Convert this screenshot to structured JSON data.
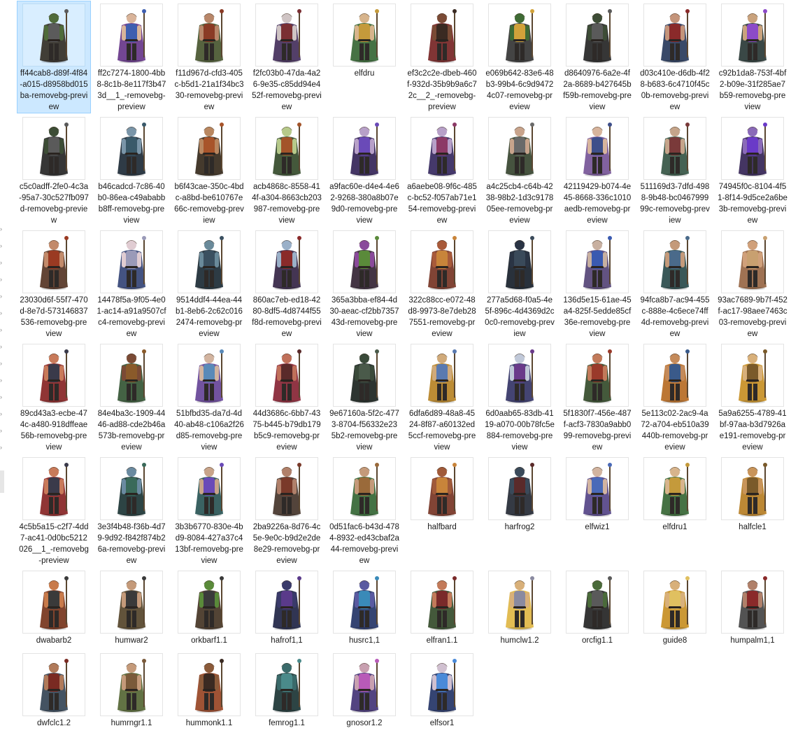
{
  "files": [
    {
      "name": "ff44cab8-d89f-4f84-a015-d8958bd015ba-removebg-preview",
      "selected": true,
      "colors": {
        "skin": "#4f6b3a",
        "cloth": "#39342c",
        "accent": "#5b5b5b"
      },
      "icon": "green-warrior-icon"
    },
    {
      "name": "ff2c7274-1800-4bb8-8c1b-8e117f3b473d__1_-removebg-preview",
      "colors": {
        "skin": "#d9b49a",
        "cloth": "#6b3c8c",
        "accent": "#3f5fb0"
      },
      "icon": "sorceress-icon"
    },
    {
      "name": "f11d967d-cfd3-405c-b5d1-21a1f34bc330-removebg-preview",
      "colors": {
        "skin": "#b8876a",
        "cloth": "#4d5b35",
        "accent": "#8a3b25"
      },
      "icon": "ranger-icon"
    },
    {
      "name": "f2fc03b0-47da-4a26-9e35-c85dd94e452f-removebg-preview",
      "colors": {
        "skin": "#cfc4c4",
        "cloth": "#4a3560",
        "accent": "#7a2f33"
      },
      "icon": "mage-icon"
    },
    {
      "name": "elfdru",
      "colors": {
        "skin": "#d7b48c",
        "cloth": "#3c6a3a",
        "accent": "#c49a3b"
      },
      "icon": "druid-icon"
    },
    {
      "name": "ef3c2c2e-dbeb-460f-932d-35b9b9a6c72c__2_-removebg-preview",
      "colors": {
        "skin": "#7a4a35",
        "cloth": "#7a2a2a",
        "accent": "#3a2a22"
      },
      "icon": "fighter-icon"
    },
    {
      "name": "e069b642-83e6-48b3-99b4-6c9d94724c07-removebg-preview",
      "colors": {
        "skin": "#3f6b35",
        "cloth": "#3a3a3a",
        "accent": "#d1a23a"
      },
      "icon": "orc-icon"
    },
    {
      "name": "d8640976-6a2e-4f2a-8689-b427645bf59b-removebg-preview",
      "colors": {
        "skin": "#3d4c36",
        "cloth": "#2b2b2b",
        "accent": "#5a5a5a"
      },
      "icon": "armored-orc-icon"
    },
    {
      "name": "d03c410e-d6db-4f28-b683-6c4710f45c0b-removebg-preview",
      "colors": {
        "skin": "#c4947a",
        "cloth": "#2e3f60",
        "accent": "#8a2a2a"
      },
      "icon": "knight-icon"
    },
    {
      "name": "c92b1da8-753f-4bf2-b09e-31f285ae7b59-removebg-preview",
      "colors": {
        "skin": "#c9a27d",
        "cloth": "#2f3e3c",
        "accent": "#8c4ac8"
      },
      "icon": "gnome-mage-icon"
    },
    {
      "name": "c5c0adff-2fe0-4c3a-95a7-30c527fb097d-removebg-preview",
      "colors": {
        "skin": "#3d4d36",
        "cloth": "#2b2b2b",
        "accent": "#5a5a5a"
      },
      "icon": "orc-guard-icon"
    },
    {
      "name": "b46cadcd-7c86-40b0-86ea-c49ababbb8ff-removebg-preview",
      "colors": {
        "skin": "#7a95a8",
        "cloth": "#24303c",
        "accent": "#3a5a6a"
      },
      "icon": "drow-icon"
    },
    {
      "name": "b6f43cae-350c-4bdc-a8bd-be610767e66c-removebg-preview",
      "colors": {
        "skin": "#b98760",
        "cloth": "#3b2f22",
        "accent": "#a8542a"
      },
      "icon": "monk-icon"
    },
    {
      "name": "acb4868c-8558-414f-a304-8663cb203987-removebg-preview",
      "colors": {
        "skin": "#b6c98a",
        "cloth": "#3a4f30",
        "accent": "#a3542a"
      },
      "icon": "goblin-icon"
    },
    {
      "name": "a9fac60e-d4e4-4e62-9268-380a8b07e9d0-removebg-preview",
      "colors": {
        "skin": "#b7a0c8",
        "cloth": "#3a2a5c",
        "accent": "#6a4ab8"
      },
      "icon": "witch-icon"
    },
    {
      "name": "a6aebe08-9f6c-485c-bc52-f057ab71e154-removebg-preview",
      "colors": {
        "skin": "#b7a0c8",
        "cloth": "#3b2e63",
        "accent": "#8c3a66"
      },
      "icon": "warlock-icon"
    },
    {
      "name": "a4c25cb4-c64b-4238-98b2-1d3c917805ee-removebg-preview",
      "colors": {
        "skin": "#c8a48c",
        "cloth": "#3c4a35",
        "accent": "#6a6a6a"
      },
      "icon": "swordsman-icon"
    },
    {
      "name": "42119429-b074-4e45-8668-336c1010aedb-removebg-preview",
      "colors": {
        "skin": "#d7b49c",
        "cloth": "#7a5a9a",
        "accent": "#3e4f8a"
      },
      "icon": "priestess-icon"
    },
    {
      "name": "511169d3-7dfd-4988-9b48-bc046799999c-removebg-preview",
      "colors": {
        "skin": "#c5a48a",
        "cloth": "#3b5a4a",
        "accent": "#7a3a3a"
      },
      "icon": "bard-icon"
    },
    {
      "name": "74945f0c-8104-4f51-8f14-9d5ce2a6be3b-removebg-preview",
      "colors": {
        "skin": "#8a6ab8",
        "cloth": "#3a2a5a",
        "accent": "#6a3ac8"
      },
      "icon": "tiefling-icon"
    },
    {
      "name": "23030d6f-55f7-470d-8e7d-573146837536-removebg-preview",
      "colors": {
        "skin": "#c28a6a",
        "cloth": "#5a3a2a",
        "accent": "#9a3a22"
      },
      "icon": "barbarian-icon"
    },
    {
      "name": "14478f5a-9f05-4e01-ac14-a91a9507cfc4-removebg-preview",
      "colors": {
        "skin": "#e0ccd2",
        "cloth": "#3a4a7a",
        "accent": "#9a9ab8"
      },
      "icon": "elf-mage-icon"
    },
    {
      "name": "9514ddf4-44ea-44b1-8eb6-2c62c0162474-removebg-preview",
      "colors": {
        "skin": "#6a8a9a",
        "cloth": "#22303a",
        "accent": "#3a5060"
      },
      "icon": "rogue-icon"
    },
    {
      "name": "860ac7eb-ed18-4280-8df5-4d8744f55f8d-removebg-preview",
      "colors": {
        "skin": "#9ab0c8",
        "cloth": "#3a2a4a",
        "accent": "#8a2a2a"
      },
      "icon": "sorcerer-icon"
    },
    {
      "name": "365a3bba-ef84-4d30-aeac-cf2bb735743d-removebg-preview",
      "colors": {
        "skin": "#8a4a9a",
        "cloth": "#3a2a3a",
        "accent": "#5a8a3a"
      },
      "icon": "jester-icon"
    },
    {
      "name": "322c88cc-e072-48d8-9973-8e7deb287551-removebg-preview",
      "colors": {
        "skin": "#a85a3a",
        "cloth": "#7a3a2a",
        "accent": "#c8843a"
      },
      "icon": "lute-bard-icon"
    },
    {
      "name": "277a5d68-f0a5-4e5f-896c-4d4369d2c0c0-removebg-preview",
      "colors": {
        "skin": "#2a3444",
        "cloth": "#1e2630",
        "accent": "#3a4a5a"
      },
      "icon": "shadow-icon"
    },
    {
      "name": "136d5e15-61ae-45a4-825f-5edde85cf36e-removebg-preview",
      "colors": {
        "skin": "#c8b0a0",
        "cloth": "#5a4a7a",
        "accent": "#3a5ab0"
      },
      "icon": "cleric-icon"
    },
    {
      "name": "94fca8b7-ac94-455c-888e-4c6ece74ff4d-removebg-preview",
      "colors": {
        "skin": "#c49a7a",
        "cloth": "#2f4f4f",
        "accent": "#4a6a8a"
      },
      "icon": "sailor-icon"
    },
    {
      "name": "93ac7689-9b7f-452f-ac17-98aee7463c03-removebg-preview",
      "colors": {
        "skin": "#d0a07a",
        "cloth": "#9a6a4a",
        "accent": "#c8a070"
      },
      "icon": "halfling-icon"
    },
    {
      "name": "89cd43a3-ecbe-474c-a480-918dffeae56b-removebg-preview",
      "colors": {
        "skin": "#c87a5a",
        "cloth": "#8a2a2a",
        "accent": "#3a3a4a"
      },
      "icon": "axe-fighter-icon"
    },
    {
      "name": "84e4ba3c-1909-4446-ad88-cde2b46a573b-removebg-preview",
      "colors": {
        "skin": "#7a4a35",
        "cloth": "#3a5a3a",
        "accent": "#8a5a2a"
      },
      "icon": "scout-icon"
    },
    {
      "name": "51bfbd35-da7d-4d40-ab48-c106a2f26d85-removebg-preview",
      "colors": {
        "skin": "#d2b4a0",
        "cloth": "#6a4a9a",
        "accent": "#5a8ab8"
      },
      "icon": "enchantress-icon"
    },
    {
      "name": "44d3686c-6bb7-4375-b445-b79db179b5c9-removebg-preview",
      "colors": {
        "skin": "#c0705a",
        "cloth": "#8a2a3a",
        "accent": "#5a2a2a"
      },
      "icon": "dancer-icon"
    },
    {
      "name": "9e67160a-5f2c-4773-8704-f56332e235b2-removebg-preview",
      "colors": {
        "skin": "#3a4a3a",
        "cloth": "#222a26",
        "accent": "#4a5a4a"
      },
      "icon": "dark-knight-icon"
    },
    {
      "name": "6dfa6d89-48a8-4524-8f87-a60132ed5ccf-removebg-preview",
      "colors": {
        "skin": "#d0aa7a",
        "cloth": "#b8862a",
        "accent": "#5a7ab0"
      },
      "icon": "paladin-icon"
    },
    {
      "name": "6d0aab65-83db-4119-a070-00b78fc5e884-removebg-preview",
      "colors": {
        "skin": "#c0c8d8",
        "cloth": "#3a3a6a",
        "accent": "#6a3a8a"
      },
      "icon": "archmage-icon"
    },
    {
      "name": "5f1830f7-456e-487f-acf3-7830a9abb099-removebg-preview",
      "colors": {
        "skin": "#c27a5a",
        "cloth": "#3a5030",
        "accent": "#9a3a2a"
      },
      "icon": "huntress-icon"
    },
    {
      "name": "5e113c02-2ac9-4a72-a704-eb510a39440b-removebg-preview",
      "colors": {
        "skin": "#c48a5a",
        "cloth": "#b8702a",
        "accent": "#3a5a8a"
      },
      "icon": "gold-knight-icon"
    },
    {
      "name": "5a9a6255-4789-41bf-97aa-b3d7926ae191-removebg-preview",
      "colors": {
        "skin": "#d8b07a",
        "cloth": "#c8922a",
        "accent": "#7a5a2a"
      },
      "icon": "sun-cleric-icon"
    },
    {
      "name": "4c5b5a15-c2f7-4dd7-ac41-0d0bc5212026__1_-removebg-preview",
      "colors": {
        "skin": "#c87a5a",
        "cloth": "#8a2a2a",
        "accent": "#3a3a4a"
      },
      "icon": "axe-fighter-icon"
    },
    {
      "name": "3e3f4b48-f36b-4d79-9d92-f842f874b26a-removebg-preview",
      "colors": {
        "skin": "#6a8aa0",
        "cloth": "#223a3a",
        "accent": "#3a6a5a"
      },
      "icon": "assassin-icon"
    },
    {
      "name": "3b3b6770-830e-4bd9-8084-427a37c413bf-removebg-preview",
      "colors": {
        "skin": "#c8a48a",
        "cloth": "#2f5a5a",
        "accent": "#6a4ab8"
      },
      "icon": "staff-mage-icon"
    },
    {
      "name": "2ba9226a-8d76-4c5e-9e0c-b9d2e2de8e29-removebg-preview",
      "colors": {
        "skin": "#b0806a",
        "cloth": "#4a3a30",
        "accent": "#7a3a2a"
      },
      "icon": "dwarf-icon"
    },
    {
      "name": "0d51fac6-b43d-4784-8932-ed43cbaf2a44-removebg-preview",
      "colors": {
        "skin": "#c49a7a",
        "cloth": "#3a6a3a",
        "accent": "#9a6a3a"
      },
      "icon": "wood-elf-icon"
    },
    {
      "name": "halfbard",
      "colors": {
        "skin": "#a05a3a",
        "cloth": "#7a3a2a",
        "accent": "#c8843a"
      },
      "icon": "halfling-bard-icon"
    },
    {
      "name": "harfrog2",
      "colors": {
        "skin": "#3a4a5a",
        "cloth": "#2a2f3a",
        "accent": "#5a2a2a"
      },
      "icon": "harfrog-icon"
    },
    {
      "name": "elfwiz1",
      "colors": {
        "skin": "#d2b4a0",
        "cloth": "#5a4a8a",
        "accent": "#4a6ab8"
      },
      "icon": "elf-wizard-icon"
    },
    {
      "name": "elfdru1",
      "colors": {
        "skin": "#d7b48c",
        "cloth": "#3c6a3a",
        "accent": "#c49a3b"
      },
      "icon": "elf-druid-icon"
    },
    {
      "name": "halfcle1",
      "colors": {
        "skin": "#c8945a",
        "cloth": "#b8822a",
        "accent": "#7a5a2a"
      },
      "icon": "halfling-cleric-icon"
    },
    {
      "name": "dwabarb2",
      "colors": {
        "skin": "#c87a4a",
        "cloth": "#7a3a22",
        "accent": "#3a3a3a"
      },
      "icon": "dwarf-barbarian-icon"
    },
    {
      "name": "humwar2",
      "colors": {
        "skin": "#c49a7a",
        "cloth": "#5a4a30",
        "accent": "#3a3a3a"
      },
      "icon": "human-warrior-icon"
    },
    {
      "name": "orkbarf1.1",
      "colors": {
        "skin": "#5a8a3a",
        "cloth": "#4a3a2a",
        "accent": "#3a3a3a"
      },
      "icon": "orc-barbarian-icon"
    },
    {
      "name": "hafrof1,1",
      "colors": {
        "skin": "#3a3a6a",
        "cloth": "#262a4a",
        "accent": "#5a3a8a"
      },
      "icon": "halfling-rogue-icon"
    },
    {
      "name": "husrc1,1",
      "colors": {
        "skin": "#5a5aa0",
        "cloth": "#2a3a6a",
        "accent": "#3a8ab8"
      },
      "icon": "human-sorcerer-icon"
    },
    {
      "name": "elfran1.1",
      "colors": {
        "skin": "#c27a5a",
        "cloth": "#3a5030",
        "accent": "#7a2a2a"
      },
      "icon": "elf-ranger-icon"
    },
    {
      "name": "humclw1.2",
      "colors": {
        "skin": "#d8b07a",
        "cloth": "#e0b84a",
        "accent": "#8a8aa0"
      },
      "icon": "human-cleric-icon"
    },
    {
      "name": "orcfig1.1",
      "colors": {
        "skin": "#4a6a3a",
        "cloth": "#2a2a2a",
        "accent": "#5a5a5a"
      },
      "icon": "orc-fighter-icon"
    },
    {
      "name": "guide8",
      "colors": {
        "skin": "#d8b07a",
        "cloth": "#c8922a",
        "accent": "#e0c060"
      },
      "icon": "guide-icon"
    },
    {
      "name": "humpalm1,1",
      "colors": {
        "skin": "#b0806a",
        "cloth": "#4a4a4a",
        "accent": "#8a2a2a"
      },
      "icon": "human-paladin-icon"
    },
    {
      "name": "dwfclc1.2",
      "colors": {
        "skin": "#b07a5a",
        "cloth": "#3a4a5a",
        "accent": "#7a2a22"
      },
      "icon": "dwarf-cleric-icon"
    },
    {
      "name": "humrngr1.1",
      "colors": {
        "skin": "#c49a7a",
        "cloth": "#5a6a3a",
        "accent": "#7a5a3a"
      },
      "icon": "human-ranger-icon"
    },
    {
      "name": "hummonk1.1",
      "colors": {
        "skin": "#8a5a3a",
        "cloth": "#9a4a2a",
        "accent": "#3a2a22"
      },
      "icon": "human-monk-icon"
    },
    {
      "name": "femrog1.1",
      "colors": {
        "skin": "#3a6a6a",
        "cloth": "#223a3a",
        "accent": "#4a8a8a"
      },
      "icon": "female-rogue-icon"
    },
    {
      "name": "gnosor1.2",
      "colors": {
        "skin": "#c8a0b0",
        "cloth": "#4a3a7a",
        "accent": "#b85ab8"
      },
      "icon": "gnome-sorcerer-icon"
    },
    {
      "name": "elfsor1",
      "colors": {
        "skin": "#d0c0d0",
        "cloth": "#2a3a6a",
        "accent": "#4a8ad8"
      },
      "icon": "elf-sorcerer-icon"
    }
  ]
}
